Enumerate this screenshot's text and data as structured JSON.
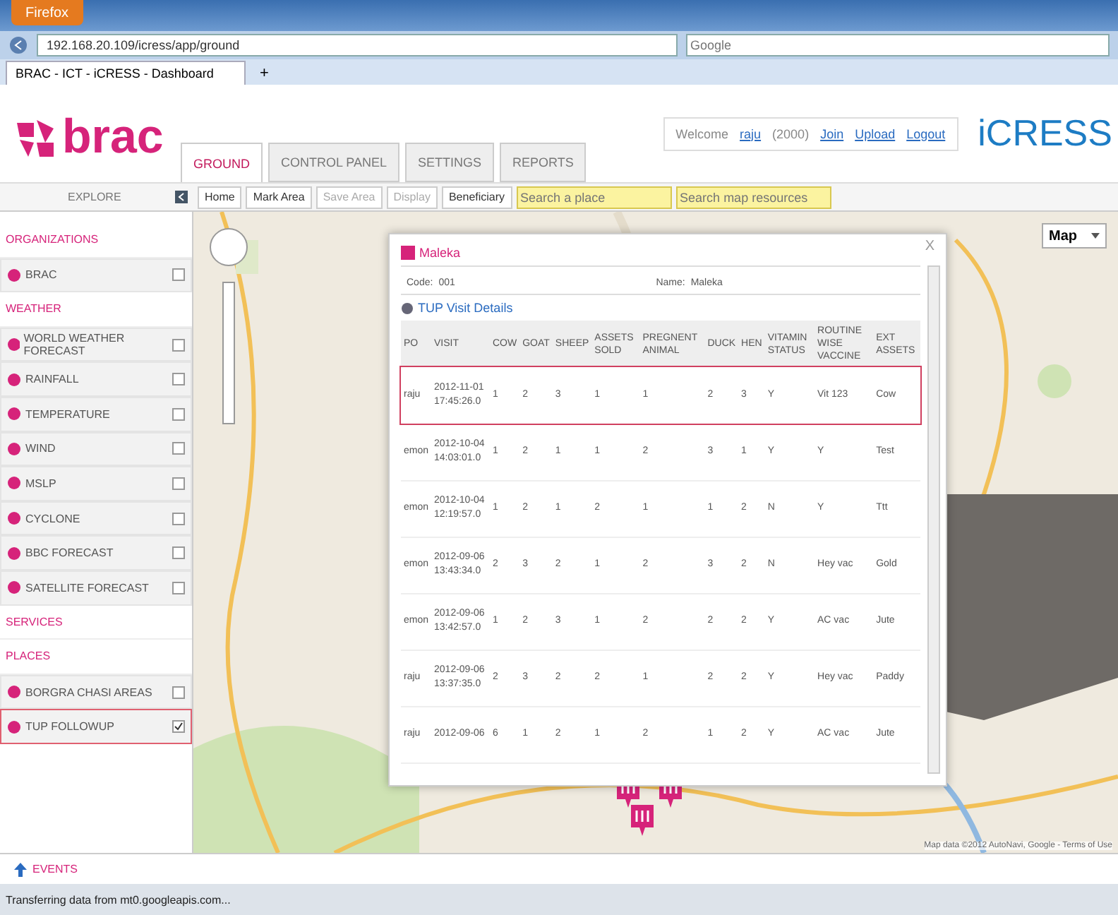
{
  "browser": {
    "menu_button": "Firefox",
    "url": "192.168.20.109/icress/app/ground",
    "search_placeholder": "Google",
    "tab_title": "BRAC - ICT - iCRESS - Dashboard",
    "new_tab": "+"
  },
  "header": {
    "logo": "brac",
    "brand": "iCRESS",
    "welcome": "Welcome",
    "user": "raju",
    "user_code": "(2000)",
    "links": [
      "Join",
      "Upload",
      "Logout"
    ],
    "tabs": [
      {
        "label": "GROUND",
        "selected": true
      },
      {
        "label": "CONTROL PANEL",
        "selected": false
      },
      {
        "label": "SETTINGS",
        "selected": false
      },
      {
        "label": "REPORTS",
        "selected": false
      }
    ]
  },
  "toolbar": {
    "explore": "EXPLORE",
    "buttons": [
      {
        "label": "Home",
        "disabled": false
      },
      {
        "label": "Mark Area",
        "disabled": false
      },
      {
        "label": "Save Area",
        "disabled": true
      },
      {
        "label": "Display",
        "disabled": true
      },
      {
        "label": "Beneficiary",
        "disabled": false
      }
    ],
    "place_placeholder": "Search a place",
    "resource_placeholder": "Search map resources"
  },
  "sidebar": {
    "items": [
      {
        "kind": "header",
        "label": "ORGANIZATIONS"
      },
      {
        "kind": "item",
        "label": "BRAC",
        "checked": false,
        "selected": false
      },
      {
        "kind": "header",
        "label": "WEATHER"
      },
      {
        "kind": "item",
        "label": "WORLD WEATHER FORECAST",
        "checked": false,
        "selected": false
      },
      {
        "kind": "item",
        "label": "RAINFALL",
        "checked": false,
        "selected": false
      },
      {
        "kind": "item",
        "label": "TEMPERATURE",
        "checked": false,
        "selected": false
      },
      {
        "kind": "item",
        "label": "WIND",
        "checked": false,
        "selected": false
      },
      {
        "kind": "item",
        "label": "MSLP",
        "checked": false,
        "selected": false
      },
      {
        "kind": "item",
        "label": "CYCLONE",
        "checked": false,
        "selected": false
      },
      {
        "kind": "item",
        "label": "BBC FORECAST",
        "checked": false,
        "selected": false
      },
      {
        "kind": "item",
        "label": "SATELLITE FORECAST",
        "checked": false,
        "selected": false
      },
      {
        "kind": "header",
        "label": "SERVICES"
      },
      {
        "kind": "header",
        "label": "PLACES"
      },
      {
        "kind": "item",
        "label": "BORGRA CHASI AREAS",
        "checked": false,
        "selected": false
      },
      {
        "kind": "item",
        "label": "TUP FOLLOWUP",
        "checked": true,
        "selected": true
      }
    ]
  },
  "map": {
    "type_selector": "Map",
    "attribution": "Map data ©2012 AutoNavi, Google - Terms of Use"
  },
  "popup": {
    "close": "X",
    "title": "Maleka",
    "code_label": "Code:",
    "code": "001",
    "name_label": "Name:",
    "name": "Maleka",
    "section": "TUP Visit Details",
    "table": {
      "columns": [
        "PO",
        "VISIT",
        "COW",
        "GOAT",
        "SHEEP",
        "ASSETS SOLD",
        "PREGNENT ANIMAL",
        "DUCK",
        "HEN",
        "VITAMIN STATUS",
        "ROUTINE WISE VACCINE",
        "EXT ASSETS"
      ],
      "rows": [
        {
          "selected": true,
          "cells": [
            "raju",
            "2012-11-01 17:45:26.0",
            "1",
            "2",
            "3",
            "1",
            "1",
            "2",
            "3",
            "Y",
            "Vit 123",
            "Cow"
          ]
        },
        {
          "selected": false,
          "cells": [
            "emon",
            "2012-10-04 14:03:01.0",
            "1",
            "2",
            "1",
            "1",
            "2",
            "3",
            "1",
            "Y",
            "Y",
            "Test"
          ]
        },
        {
          "selected": false,
          "cells": [
            "emon",
            "2012-10-04 12:19:57.0",
            "1",
            "2",
            "1",
            "2",
            "1",
            "1",
            "2",
            "N",
            "Y",
            "Ttt"
          ]
        },
        {
          "selected": false,
          "cells": [
            "emon",
            "2012-09-06 13:43:34.0",
            "2",
            "3",
            "2",
            "1",
            "2",
            "3",
            "2",
            "N",
            "Hey vac",
            "Gold"
          ]
        },
        {
          "selected": false,
          "cells": [
            "emon",
            "2012-09-06 13:42:57.0",
            "1",
            "2",
            "3",
            "1",
            "2",
            "2",
            "2",
            "Y",
            "AC vac",
            "Jute"
          ]
        },
        {
          "selected": false,
          "cells": [
            "raju",
            "2012-09-06 13:37:35.0",
            "2",
            "3",
            "2",
            "2",
            "1",
            "2",
            "2",
            "Y",
            "Hey vac",
            "Paddy"
          ]
        },
        {
          "selected": false,
          "cells": [
            "raju",
            "2012-09-06",
            "6",
            "1",
            "2",
            "1",
            "2",
            "1",
            "2",
            "Y",
            "AC vac",
            "Jute"
          ]
        }
      ]
    }
  },
  "events": "EVENTS",
  "status_bar": "Transferring data from mt0.googleapis.com..."
}
